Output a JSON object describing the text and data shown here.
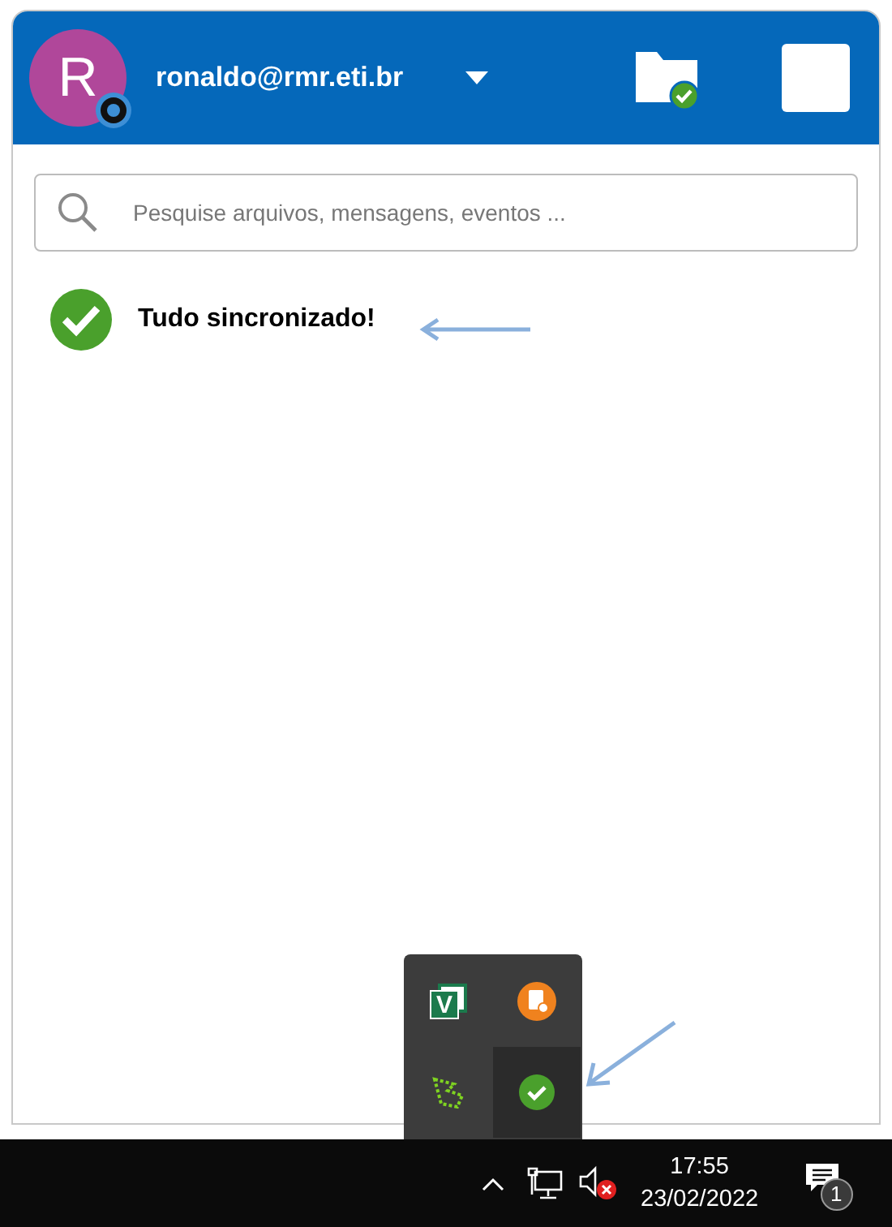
{
  "header": {
    "avatar_initial": "R",
    "account": "ronaldo@rmr.eti.br"
  },
  "search": {
    "placeholder": "Pesquise arquivos, mensagens, eventos ..."
  },
  "status": {
    "message": "Tudo sincronizado!"
  },
  "tray_popup": [
    {
      "kind": "letter",
      "label": "V",
      "selected": false
    },
    {
      "kind": "orange",
      "selected": false
    },
    {
      "kind": "dotted",
      "selected": false
    },
    {
      "kind": "check",
      "selected": true
    }
  ],
  "taskbar": {
    "time": "17:55",
    "date": "23/02/2022",
    "notification_count": "1"
  }
}
